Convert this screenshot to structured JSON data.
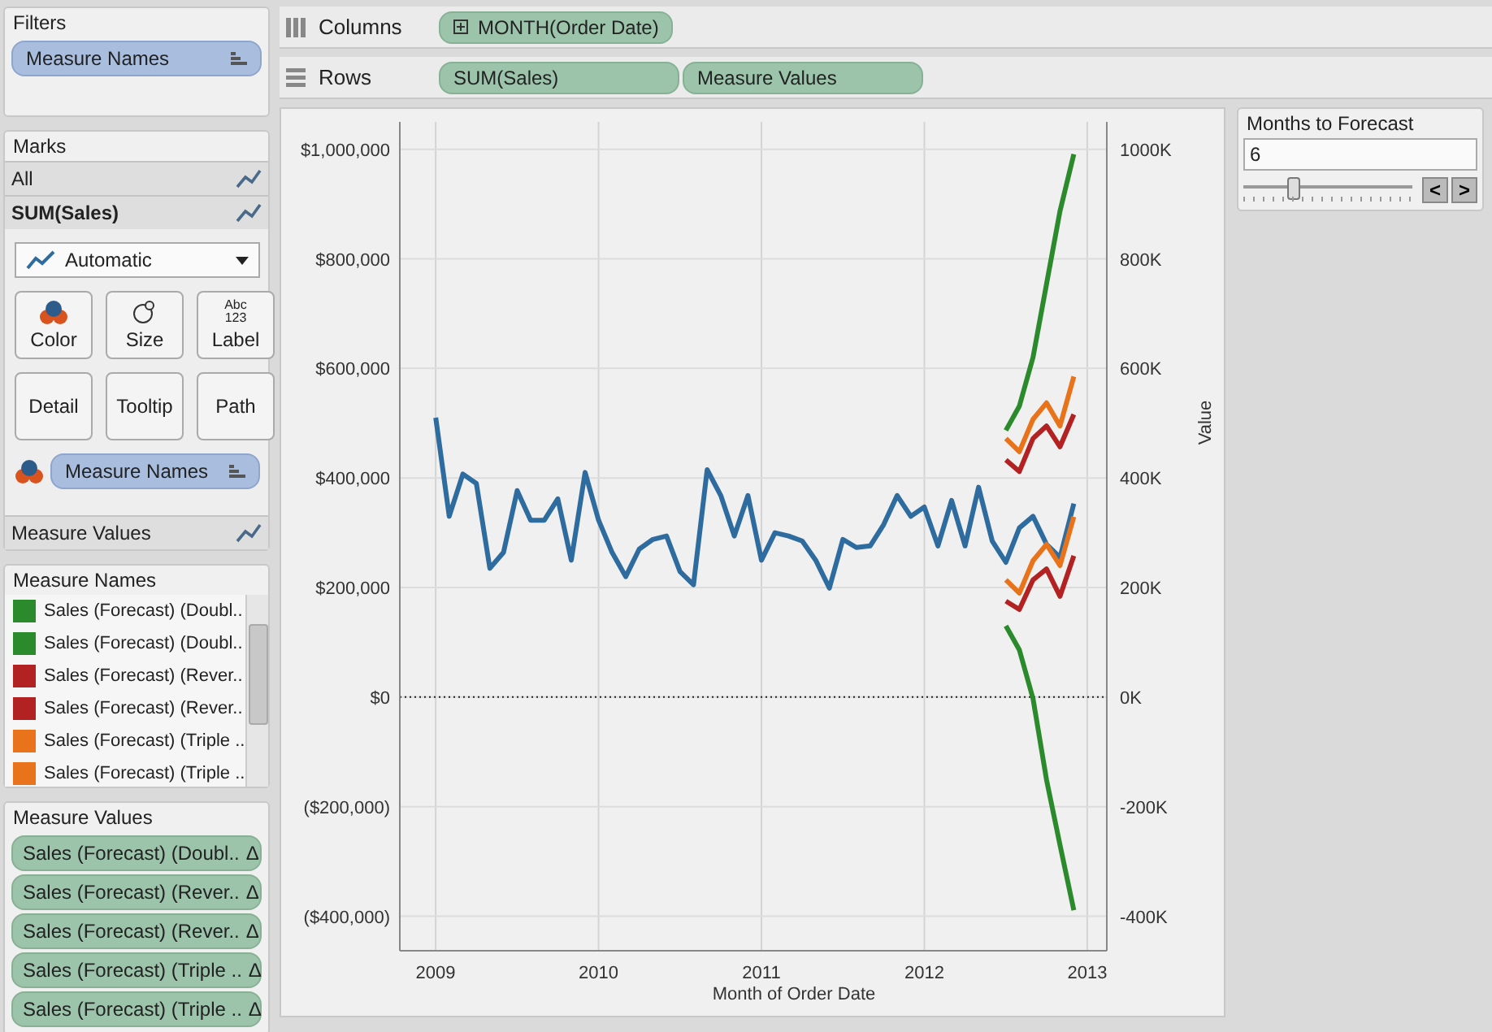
{
  "filters": {
    "title": "Filters",
    "pills": [
      {
        "label": "Measure Names"
      }
    ]
  },
  "marks": {
    "title": "Marks",
    "layers": [
      {
        "label": "All",
        "selected": false
      },
      {
        "label": "SUM(Sales)",
        "selected": true
      },
      {
        "label": "Measure Values",
        "selected": false
      }
    ],
    "mark_type": "Automatic",
    "cards": [
      {
        "kind": "color",
        "label": "Color"
      },
      {
        "kind": "size",
        "label": "Size"
      },
      {
        "kind": "label",
        "label": "Label",
        "icon_lines": [
          "Abc",
          "123"
        ]
      },
      {
        "kind": "detail",
        "label": "Detail"
      },
      {
        "kind": "tooltip",
        "label": "Tooltip"
      },
      {
        "kind": "path",
        "label": "Path"
      }
    ],
    "color_pill": "Measure Names"
  },
  "legend": {
    "title": "Measure Names",
    "items": [
      {
        "label": "Sales (Forecast) (Doubl..",
        "color": "#2b8a2b"
      },
      {
        "label": "Sales (Forecast) (Doubl..",
        "color": "#2b8a2b"
      },
      {
        "label": "Sales (Forecast) (Rever..",
        "color": "#b22222"
      },
      {
        "label": "Sales (Forecast) (Rever..",
        "color": "#b22222"
      },
      {
        "label": "Sales (Forecast) (Triple ..",
        "color": "#e8731a"
      },
      {
        "label": "Sales (Forecast) (Triple ..",
        "color": "#e8731a"
      }
    ]
  },
  "measure_values": {
    "title": "Measure Values",
    "pills": [
      {
        "label": "Sales (Forecast) (Doubl..",
        "mark": "Δ"
      },
      {
        "label": "Sales (Forecast) (Rever..",
        "mark": "Δ"
      },
      {
        "label": "Sales (Forecast) (Rever..",
        "mark": "Δ"
      },
      {
        "label": "Sales (Forecast) (Triple ..",
        "mark": "Δ"
      },
      {
        "label": "Sales (Forecast) (Triple ..",
        "mark": "Δ"
      }
    ]
  },
  "shelves": [
    {
      "kind": "columns",
      "label": "Columns",
      "pills": [
        {
          "label": "MONTH(Order Date)",
          "expandable": true
        }
      ]
    },
    {
      "kind": "rows",
      "label": "Rows",
      "pills": [
        {
          "label": "SUM(Sales)",
          "expandable": false
        },
        {
          "label": "Measure Values",
          "expandable": false
        }
      ]
    }
  ],
  "chart": {
    "chart_data": {
      "type": "line",
      "xlabel": "Month of Order Date",
      "y2label": "Value",
      "xlim": [
        2008.78,
        2013.12
      ],
      "ylim": [
        -463000,
        1050000
      ],
      "y2lim": [
        -463000,
        1050000
      ],
      "grid": true,
      "ref_lines": [
        {
          "axis": "y",
          "value": 0
        }
      ],
      "xticks": [
        2009,
        2010,
        2011,
        2012,
        2013
      ],
      "yticks": [
        {
          "value": 1000000,
          "label": "$1,000,000"
        },
        {
          "value": 800000,
          "label": "$800,000"
        },
        {
          "value": 600000,
          "label": "$600,000"
        },
        {
          "value": 400000,
          "label": "$400,000"
        },
        {
          "value": 200000,
          "label": "$200,000"
        },
        {
          "value": 0,
          "label": "$0"
        },
        {
          "value": -200000,
          "label": "($200,000)"
        },
        {
          "value": -400000,
          "label": "($400,000)"
        }
      ],
      "y2ticks": [
        {
          "value": 1000000,
          "label": "1000K"
        },
        {
          "value": 800000,
          "label": "800K"
        },
        {
          "value": 600000,
          "label": "600K"
        },
        {
          "value": 400000,
          "label": "400K"
        },
        {
          "value": 200000,
          "label": "200K"
        },
        {
          "value": 0,
          "label": "0K"
        },
        {
          "value": -200000,
          "label": "-200K"
        },
        {
          "value": -400000,
          "label": "-400K"
        }
      ],
      "x": [
        2009,
        2009.083,
        2009.167,
        2009.25,
        2009.333,
        2009.417,
        2009.5,
        2009.583,
        2009.667,
        2009.75,
        2009.833,
        2009.917,
        2010,
        2010.083,
        2010.167,
        2010.25,
        2010.333,
        2010.417,
        2010.5,
        2010.583,
        2010.667,
        2010.75,
        2010.833,
        2010.917,
        2011,
        2011.083,
        2011.167,
        2011.25,
        2011.333,
        2011.417,
        2011.5,
        2011.583,
        2011.667,
        2011.75,
        2011.833,
        2011.917,
        2012,
        2012.083,
        2012.167,
        2012.25,
        2012.333,
        2012.417,
        2012.5,
        2012.583,
        2012.667,
        2012.75,
        2012.833,
        2012.917
      ],
      "series": [
        {
          "color": "#2e6b9e",
          "values": [
            510000,
            330000,
            407000,
            390000,
            235000,
            264000,
            377000,
            323000,
            323000,
            362000,
            250000,
            410000,
            323000,
            264000,
            220000,
            270000,
            288000,
            294000,
            229000,
            205000,
            415000,
            368000,
            294000,
            368000,
            250000,
            300000,
            294000,
            285000,
            250000,
            199000,
            288000,
            273000,
            276000,
            315000,
            368000,
            330000,
            347000,
            276000,
            359000,
            276000,
            383000,
            285000,
            246000,
            309000,
            330000,
            279000,
            255000,
            353000
          ]
        },
        {
          "color": "#2b8a2b",
          "values": [
            null,
            null,
            null,
            null,
            null,
            null,
            null,
            null,
            null,
            null,
            null,
            null,
            null,
            null,
            null,
            null,
            null,
            null,
            null,
            null,
            null,
            null,
            null,
            null,
            null,
            null,
            null,
            null,
            null,
            null,
            null,
            null,
            null,
            null,
            null,
            null,
            null,
            null,
            null,
            null,
            null,
            null,
            487000,
            531000,
            620000,
            754000,
            887000,
            991000
          ]
        },
        {
          "color": "#2b8a2b",
          "values": [
            null,
            null,
            null,
            null,
            null,
            null,
            null,
            null,
            null,
            null,
            null,
            null,
            null,
            null,
            null,
            null,
            null,
            null,
            null,
            null,
            null,
            null,
            null,
            null,
            null,
            null,
            null,
            null,
            null,
            null,
            null,
            null,
            null,
            null,
            null,
            null,
            null,
            null,
            null,
            null,
            null,
            null,
            130000,
            86000,
            -3000,
            -151000,
            -270000,
            -389000
          ]
        },
        {
          "color": "#b22222",
          "values": [
            null,
            null,
            null,
            null,
            null,
            null,
            null,
            null,
            null,
            null,
            null,
            null,
            null,
            null,
            null,
            null,
            null,
            null,
            null,
            null,
            null,
            null,
            null,
            null,
            null,
            null,
            null,
            null,
            null,
            null,
            null,
            null,
            null,
            null,
            null,
            null,
            null,
            null,
            null,
            null,
            null,
            null,
            433000,
            412000,
            472000,
            495000,
            457000,
            516000
          ]
        },
        {
          "color": "#b22222",
          "values": [
            null,
            null,
            null,
            null,
            null,
            null,
            null,
            null,
            null,
            null,
            null,
            null,
            null,
            null,
            null,
            null,
            null,
            null,
            null,
            null,
            null,
            null,
            null,
            null,
            null,
            null,
            null,
            null,
            null,
            null,
            null,
            null,
            null,
            null,
            null,
            null,
            null,
            null,
            null,
            null,
            null,
            null,
            175000,
            160000,
            214000,
            234000,
            184000,
            258000
          ]
        },
        {
          "color": "#e8731a",
          "values": [
            null,
            null,
            null,
            null,
            null,
            null,
            null,
            null,
            null,
            null,
            null,
            null,
            null,
            null,
            null,
            null,
            null,
            null,
            null,
            null,
            null,
            null,
            null,
            null,
            null,
            null,
            null,
            null,
            null,
            null,
            null,
            null,
            null,
            null,
            null,
            null,
            null,
            null,
            null,
            null,
            null,
            null,
            472000,
            448000,
            507000,
            537000,
            495000,
            585000
          ]
        },
        {
          "color": "#e8731a",
          "values": [
            null,
            null,
            null,
            null,
            null,
            null,
            null,
            null,
            null,
            null,
            null,
            null,
            null,
            null,
            null,
            null,
            null,
            null,
            null,
            null,
            null,
            null,
            null,
            null,
            null,
            null,
            null,
            null,
            null,
            null,
            null,
            null,
            null,
            null,
            null,
            null,
            null,
            null,
            null,
            null,
            null,
            null,
            214000,
            190000,
            249000,
            279000,
            240000,
            329000
          ]
        }
      ]
    }
  },
  "parameter": {
    "title": "Months to Forecast",
    "value": "6",
    "level": 0.3,
    "prev": "<",
    "next": ">"
  }
}
